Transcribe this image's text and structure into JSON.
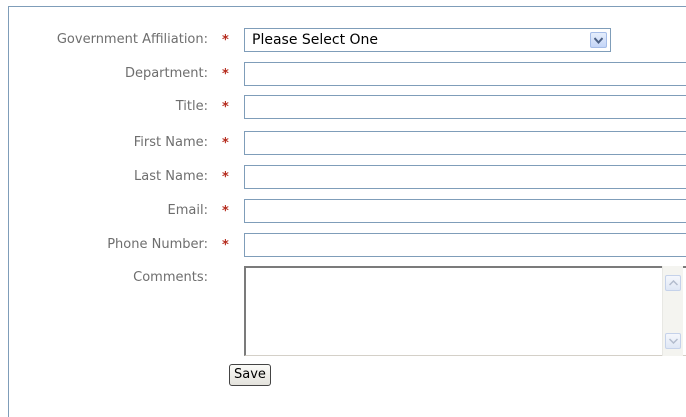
{
  "form": {
    "fields": [
      {
        "label": "Government Affiliation:",
        "required": "*",
        "type": "select",
        "value": "Please Select One"
      },
      {
        "label": "Department:",
        "required": "*",
        "type": "text",
        "value": ""
      },
      {
        "label": "Title:",
        "required": "*",
        "type": "text",
        "value": ""
      },
      {
        "label": "First Name:",
        "required": "*",
        "type": "text",
        "value": ""
      },
      {
        "label": "Last Name:",
        "required": "*",
        "type": "text",
        "value": ""
      },
      {
        "label": "Email:",
        "required": "*",
        "type": "text",
        "value": ""
      },
      {
        "label": "Phone Number:",
        "required": "*",
        "type": "text",
        "value": ""
      }
    ],
    "comments": {
      "label": "Comments:",
      "value": ""
    },
    "save_label": "Save"
  },
  "icons": {
    "select_arrow": "chevron-down-icon",
    "scroll_up": "scroll-up-arrow-icon",
    "scroll_down": "scroll-down-arrow-icon"
  },
  "colors": {
    "label": "#6e6e6e",
    "required": "#b52b1d",
    "border": "#7f9db9"
  }
}
